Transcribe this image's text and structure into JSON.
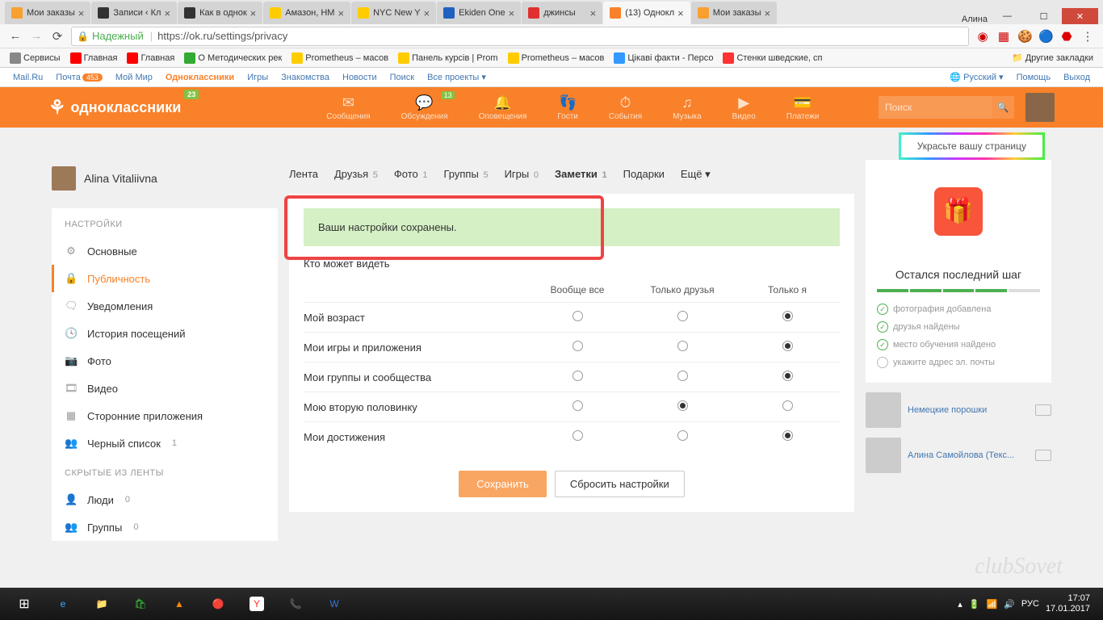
{
  "browser": {
    "tabs": [
      {
        "title": "Мои заказы",
        "fav": "#f8a030"
      },
      {
        "title": "Записи ‹ Кл",
        "fav": "#333"
      },
      {
        "title": "Как в однок",
        "fav": "#333"
      },
      {
        "title": "Амазон, НМ",
        "fav": "#fc0"
      },
      {
        "title": "NYC New Y",
        "fav": "#fc0"
      },
      {
        "title": "Ekiden One",
        "fav": "#2060c0"
      },
      {
        "title": "джинсы",
        "fav": "#e03030"
      },
      {
        "title": "(13) Однокл",
        "fav": "#f8812a",
        "active": true
      },
      {
        "title": "Мои заказы",
        "fav": "#f8a030"
      }
    ],
    "user": "Алина",
    "secure": "Надежный",
    "url": "https://ok.ru/settings/privacy"
  },
  "bookmarks": [
    "Сервисы",
    "Главная",
    "Главная",
    "О Методических рек",
    "Prometheus – масов",
    "Панель курсів | Prom",
    "Prometheus – масов",
    "Цікаві факти - Персо",
    "Стенки шведские, сп"
  ],
  "bm_more": "Другие закладки",
  "mailru": {
    "items": [
      "Mail.Ru",
      "Почта",
      "Мой Мир",
      "Одноклассники",
      "Игры",
      "Знакомства",
      "Новости",
      "Поиск",
      "Все проекты"
    ],
    "mail_badge": "453",
    "lang": "Русский",
    "help": "Помощь",
    "exit": "Выход"
  },
  "ok": {
    "logo": "одноклассники",
    "logo_badge": "23",
    "nav": [
      {
        "label": "Сообщения",
        "icon": "✉"
      },
      {
        "label": "Обсуждения",
        "icon": "💬",
        "badge": "13"
      },
      {
        "label": "Оповещения",
        "icon": "🔔"
      },
      {
        "label": "Гости",
        "icon": "👣"
      },
      {
        "label": "События",
        "icon": "⏱"
      },
      {
        "label": "Музыка",
        "icon": "♫"
      },
      {
        "label": "Видео",
        "icon": "▶"
      },
      {
        "label": "Платежи",
        "icon": "💳"
      }
    ],
    "search_ph": "Поиск"
  },
  "decorate": "Украсьте вашу страницу",
  "profile": {
    "name": "Alina Vitaliivna"
  },
  "tabs_nav": [
    {
      "label": "Лента",
      "count": ""
    },
    {
      "label": "Друзья",
      "count": "5"
    },
    {
      "label": "Фото",
      "count": "1"
    },
    {
      "label": "Группы",
      "count": "5"
    },
    {
      "label": "Игры",
      "count": "0"
    },
    {
      "label": "Заметки",
      "count": "1",
      "active": true
    },
    {
      "label": "Подарки",
      "count": ""
    },
    {
      "label": "Ещё ▾",
      "count": ""
    }
  ],
  "sidebar": {
    "title": "НАСТРОЙКИ",
    "items": [
      {
        "icon": "⚙",
        "label": "Основные"
      },
      {
        "icon": "🔒",
        "label": "Публичность",
        "active": true
      },
      {
        "icon": "🗨",
        "label": "Уведомления"
      },
      {
        "icon": "🕓",
        "label": "История посещений"
      },
      {
        "icon": "📷",
        "label": "Фото"
      },
      {
        "icon": "🎞",
        "label": "Видео"
      },
      {
        "icon": "▦",
        "label": "Сторонние приложения"
      },
      {
        "icon": "👥",
        "label": "Черный список",
        "count": "1"
      }
    ],
    "title2": "СКРЫТЫЕ ИЗ ЛЕНТЫ",
    "items2": [
      {
        "icon": "👤",
        "label": "Люди",
        "count": "0"
      },
      {
        "icon": "👥",
        "label": "Группы",
        "count": "0"
      }
    ]
  },
  "success": "Ваши настройки сохранены.",
  "priv": {
    "title": "Кто может видеть",
    "cols": [
      "Вообще все",
      "Только друзья",
      "Только я"
    ],
    "rows": [
      {
        "label": "Мой возраст",
        "sel": 2
      },
      {
        "label": "Мои игры и приложения",
        "sel": 2
      },
      {
        "label": "Мои группы и сообщества",
        "sel": 2
      },
      {
        "label": "Мою вторую половинку",
        "sel": 1
      },
      {
        "label": "Мои достижения",
        "sel": 2
      }
    ],
    "save": "Сохранить",
    "reset": "Сбросить настройки"
  },
  "promo": {
    "title": "Остался последний шаг",
    "checks": [
      {
        "label": "фотография добавлена",
        "done": true
      },
      {
        "label": "друзья найдены",
        "done": true
      },
      {
        "label": "место обучения найдено",
        "done": true
      },
      {
        "label": "укажите адрес эл. почты",
        "done": false
      }
    ],
    "ads": [
      {
        "label": "Немецкие порошки"
      },
      {
        "label": "Алина Самойлова (Текс..."
      }
    ]
  },
  "taskbar": {
    "lang": "РУС",
    "time": "17:07",
    "date": "17.01.2017"
  },
  "watermark": "clubSovet"
}
